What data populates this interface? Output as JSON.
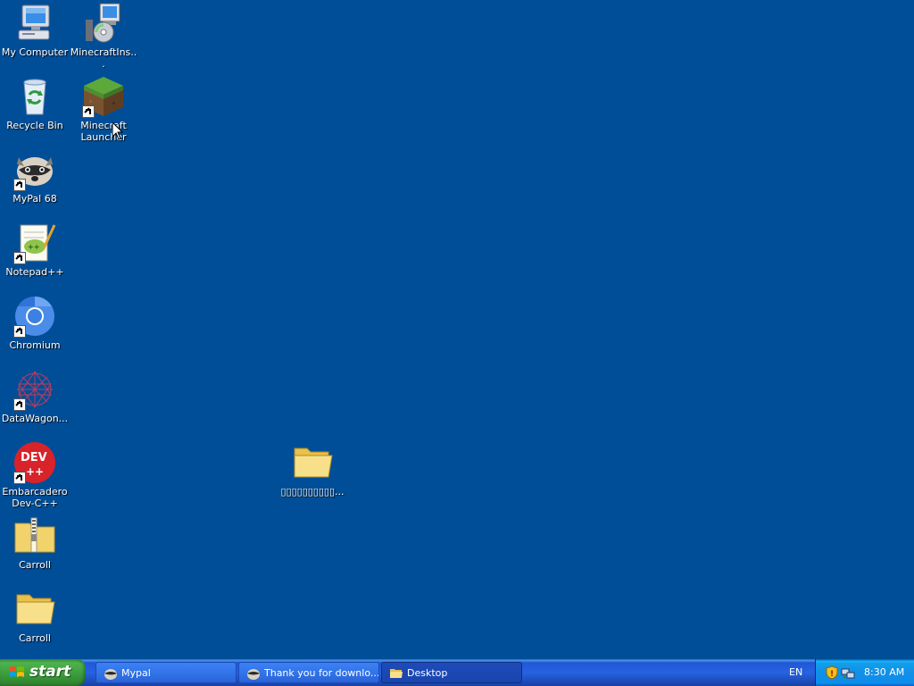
{
  "desktop": {
    "icons": [
      {
        "label": "My Computer",
        "icon": "my-computer-icon"
      },
      {
        "label": "MinecraftIns...",
        "icon": "installer-icon"
      },
      {
        "label": "Recycle Bin",
        "icon": "recycle-bin-icon"
      },
      {
        "label": "Minecraft Launcher",
        "icon": "minecraft-icon"
      },
      {
        "label": "MyPal 68",
        "icon": "mypal-icon"
      },
      {
        "label": "Notepad++",
        "icon": "notepadpp-icon"
      },
      {
        "label": "Chromium",
        "icon": "chromium-icon"
      },
      {
        "label": "DataWagon...",
        "icon": "datawagon-icon"
      },
      {
        "label": "Embarcadero Dev-C++",
        "icon": "devcpp-icon"
      },
      {
        "label": "Carroll",
        "icon": "zip-folder-icon"
      },
      {
        "label": "Carroll",
        "icon": "folder-icon"
      },
      {
        "label": "▯▯▯▯▯▯▯▯▯▯...",
        "icon": "folder-icon"
      }
    ],
    "background_color": "#004e98"
  },
  "taskbar": {
    "start_label": "start",
    "tasks": [
      {
        "label": "Mypal",
        "icon": "mypal-icon"
      },
      {
        "label": "Thank you for downlo...",
        "icon": "mypal-icon"
      },
      {
        "label": "Desktop",
        "icon": "folder-icon"
      }
    ],
    "language": "EN",
    "clock": "8:30 AM"
  }
}
